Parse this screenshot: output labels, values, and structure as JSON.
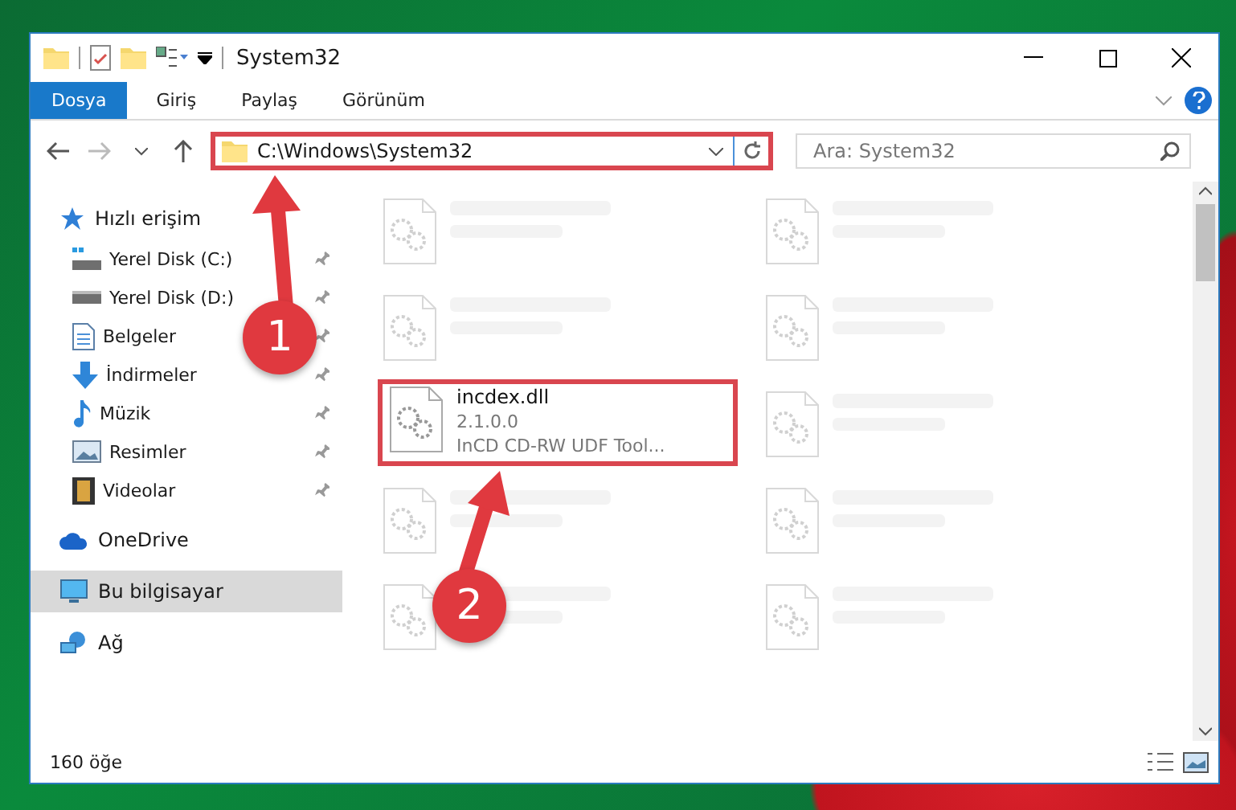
{
  "window": {
    "title": "System32"
  },
  "ribbon_tabs": [
    {
      "label": "Dosya",
      "selected": true
    },
    {
      "label": "Giriş",
      "selected": false
    },
    {
      "label": "Paylaş",
      "selected": false
    },
    {
      "label": "Görünüm",
      "selected": false
    }
  ],
  "address_bar": {
    "path": "C:\\Windows\\System32",
    "highlighted": true
  },
  "search": {
    "placeholder": "Ara: System32"
  },
  "sidebar": {
    "items": [
      {
        "label": "Hızlı erişim",
        "selected": false,
        "children": [
          {
            "label": "Yerel Disk (C:)",
            "pinned": true
          },
          {
            "label": "Yerel Disk (D:)",
            "pinned": true
          },
          {
            "label": "Belgeler",
            "pinned": true
          },
          {
            "label": "İndirmeler",
            "pinned": true
          },
          {
            "label": "Müzik",
            "pinned": true
          },
          {
            "label": "Resimler",
            "pinned": true
          },
          {
            "label": "Videolar",
            "pinned": true
          }
        ]
      },
      {
        "label": "OneDrive",
        "selected": false
      },
      {
        "label": "Bu bilgisayar",
        "selected": true
      },
      {
        "label": "Ağ",
        "selected": false
      }
    ]
  },
  "files": [
    {
      "blurred": true
    },
    {
      "blurred": true
    },
    {
      "blurred": true
    },
    {
      "blurred": true
    },
    {
      "name": "incdex.dll",
      "details": [
        "2.1.0.0",
        "InCD CD-RW UDF Tool..."
      ],
      "blurred": false,
      "highlighted": true
    },
    {
      "blurred": true
    },
    {
      "blurred": true
    },
    {
      "blurred": true
    },
    {
      "blurred": true
    },
    {
      "blurred": true
    }
  ],
  "status_bar": {
    "count": "160 öğe"
  },
  "annotations": [
    {
      "number": "1"
    },
    {
      "number": "2"
    }
  ]
}
